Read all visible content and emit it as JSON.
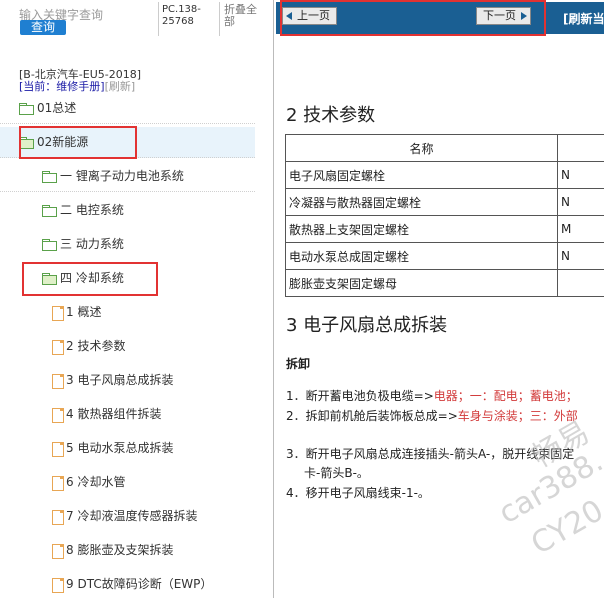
{
  "search": {
    "placeholder": "输入关键字查询",
    "button": "查询"
  },
  "pc_code": "PC.138-25768",
  "fold_all": "折叠全部",
  "book_title": "[B-北京汽车-EU5-2018]",
  "current_prefix": "[当前：",
  "current_label": "维修手册]",
  "refresh_link": "[刷新]",
  "tree": [
    {
      "label": "01总述",
      "kind": "folder"
    },
    {
      "label": "02新能源",
      "kind": "folder-open"
    },
    {
      "label": "一 锂离子动力电池系统",
      "kind": "folder"
    },
    {
      "label": "二 电控系统",
      "kind": "folder"
    },
    {
      "label": "三 动力系统",
      "kind": "folder"
    },
    {
      "label": "四 冷却系统",
      "kind": "folder-open"
    },
    {
      "label": "1 概述",
      "kind": "page"
    },
    {
      "label": "2 技术参数",
      "kind": "page"
    },
    {
      "label": "3 电子风扇总成拆装",
      "kind": "page"
    },
    {
      "label": "4 散热器组件拆装",
      "kind": "page"
    },
    {
      "label": "5 电动水泵总成拆装",
      "kind": "page"
    },
    {
      "label": "6 冷却水管",
      "kind": "page"
    },
    {
      "label": "7 冷却液温度传感器拆装",
      "kind": "page"
    },
    {
      "label": "8 膨胀壶及支架拆装",
      "kind": "page"
    },
    {
      "label": "9 DTC故障码诊断（EWP）",
      "kind": "page"
    }
  ],
  "toolbar": {
    "prev": "上一页",
    "next": "下一页",
    "refresh": "[刷新当"
  },
  "doc": {
    "tech_title": "2 技术参数",
    "table_header": [
      "名称",
      ""
    ],
    "table_rows": [
      [
        "电子风扇固定螺栓",
        "N"
      ],
      [
        "冷凝器与散热器固定螺栓",
        "N"
      ],
      [
        "散热器上支架固定螺栓",
        "M"
      ],
      [
        "电动水泵总成固定螺栓",
        "N"
      ],
      [
        "膨胀壶支架固定螺母",
        ""
      ]
    ],
    "fan_title": "3 电子风扇总成拆装",
    "remove_title": "拆卸",
    "step1_a": "1．断开蓄电池负极电缆=>",
    "step1_b": "电器；一：配电；蓄电池；",
    "step2_a": "2．拆卸前机舱后装饰板总成=>",
    "step2_b": "车身与涂装；三：外部",
    "step3_line1": "3．断开电子风扇总成连接插头-箭头A-，脱开线束固定",
    "step3_line2": "卡-箭头B-。",
    "step4": "4．移开电子风扇线束-1-。"
  },
  "watermark": [
    "畅易",
    "car388.",
    "CY20"
  ]
}
